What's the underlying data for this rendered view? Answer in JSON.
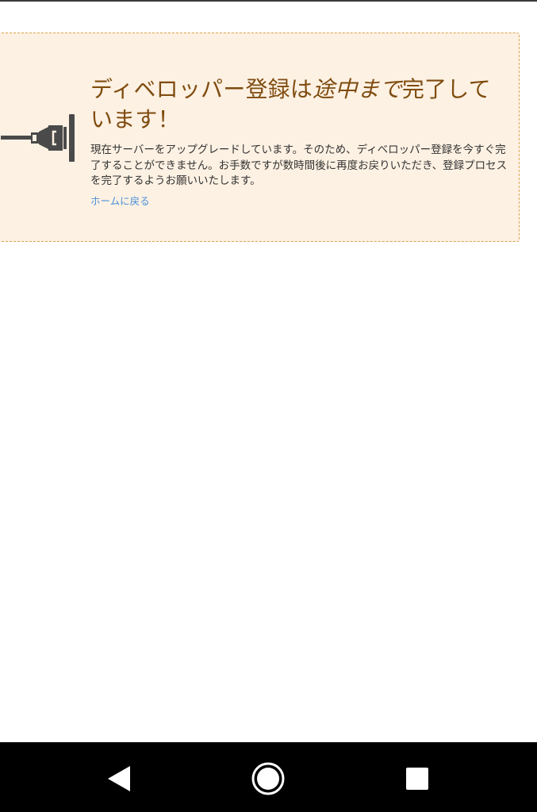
{
  "notice": {
    "title_part1": "ディベロッパー登録は",
    "title_emphasis": "途中まで",
    "title_part2": "完了しています！",
    "description": "現在サーバーをアップグレードしています。そのため、ディベロッパー登録を今すぐ完了することができません。お手数ですが数時間後に再度お戻りいただき、登録プロセスを完了するようお願いいたします。",
    "home_link": "ホームに戻る",
    "plug_icon": "plug-icon",
    "colors": {
      "background": "#fdf1e3",
      "border": "#d9a24f",
      "title": "#7f4c10",
      "link": "#4a90d9"
    }
  },
  "navigation_bar": {
    "back_icon": "back-triangle-icon",
    "home_icon": "home-circle-icon",
    "recents_icon": "recents-square-icon"
  }
}
